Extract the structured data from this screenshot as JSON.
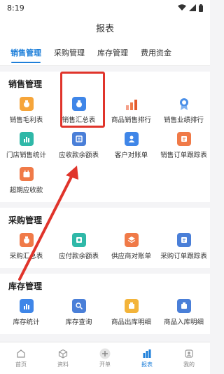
{
  "status": {
    "time": "8:19"
  },
  "page_title": "报表",
  "tabs": [
    {
      "label": "销售管理",
      "active": true
    },
    {
      "label": "采购管理",
      "active": false
    },
    {
      "label": "库存管理",
      "active": false
    },
    {
      "label": "费用资金",
      "active": false
    }
  ],
  "sections": [
    {
      "title": "销售管理",
      "items": [
        "销售毛利表",
        "销售汇总表",
        "商品销售排行",
        "销售业绩排行",
        "门店销售统计",
        "应收款余额表",
        "客户对账单",
        "销售订单跟踪表",
        "超期应收款"
      ]
    },
    {
      "title": "采购管理",
      "items": [
        "采购汇总表",
        "应付款余额表",
        "供应商对账单",
        "采购订单跟踪表"
      ]
    },
    {
      "title": "库存管理",
      "items": [
        "库存统计",
        "库存查询",
        "商品出库明细",
        "商品入库明细"
      ]
    }
  ],
  "bottom_nav": [
    {
      "label": "首页",
      "active": false
    },
    {
      "label": "资料",
      "active": false
    },
    {
      "label": "开单",
      "active": false
    },
    {
      "label": "报表",
      "active": true
    },
    {
      "label": "我的",
      "active": false
    }
  ],
  "colors": {
    "accent": "#1e7fd9",
    "highlight": "#e0342b"
  },
  "icons": {
    "sales": [
      "money-bag-icon",
      "money-bag-icon",
      "bar-chart-up-icon",
      "medal-icon",
      "store-chart-icon",
      "receivable-icon",
      "customer-icon",
      "order-track-icon",
      "calendar-icon"
    ],
    "purchase": [
      "purchase-bag-icon",
      "payable-icon",
      "layers-icon",
      "order-track-icon"
    ],
    "inventory": [
      "bar-chart-icon",
      "search-doc-icon",
      "outbound-box-icon",
      "inbound-box-icon"
    ],
    "nav": [
      "home-icon",
      "cube-icon",
      "plus-icon",
      "report-icon",
      "profile-icon"
    ]
  }
}
